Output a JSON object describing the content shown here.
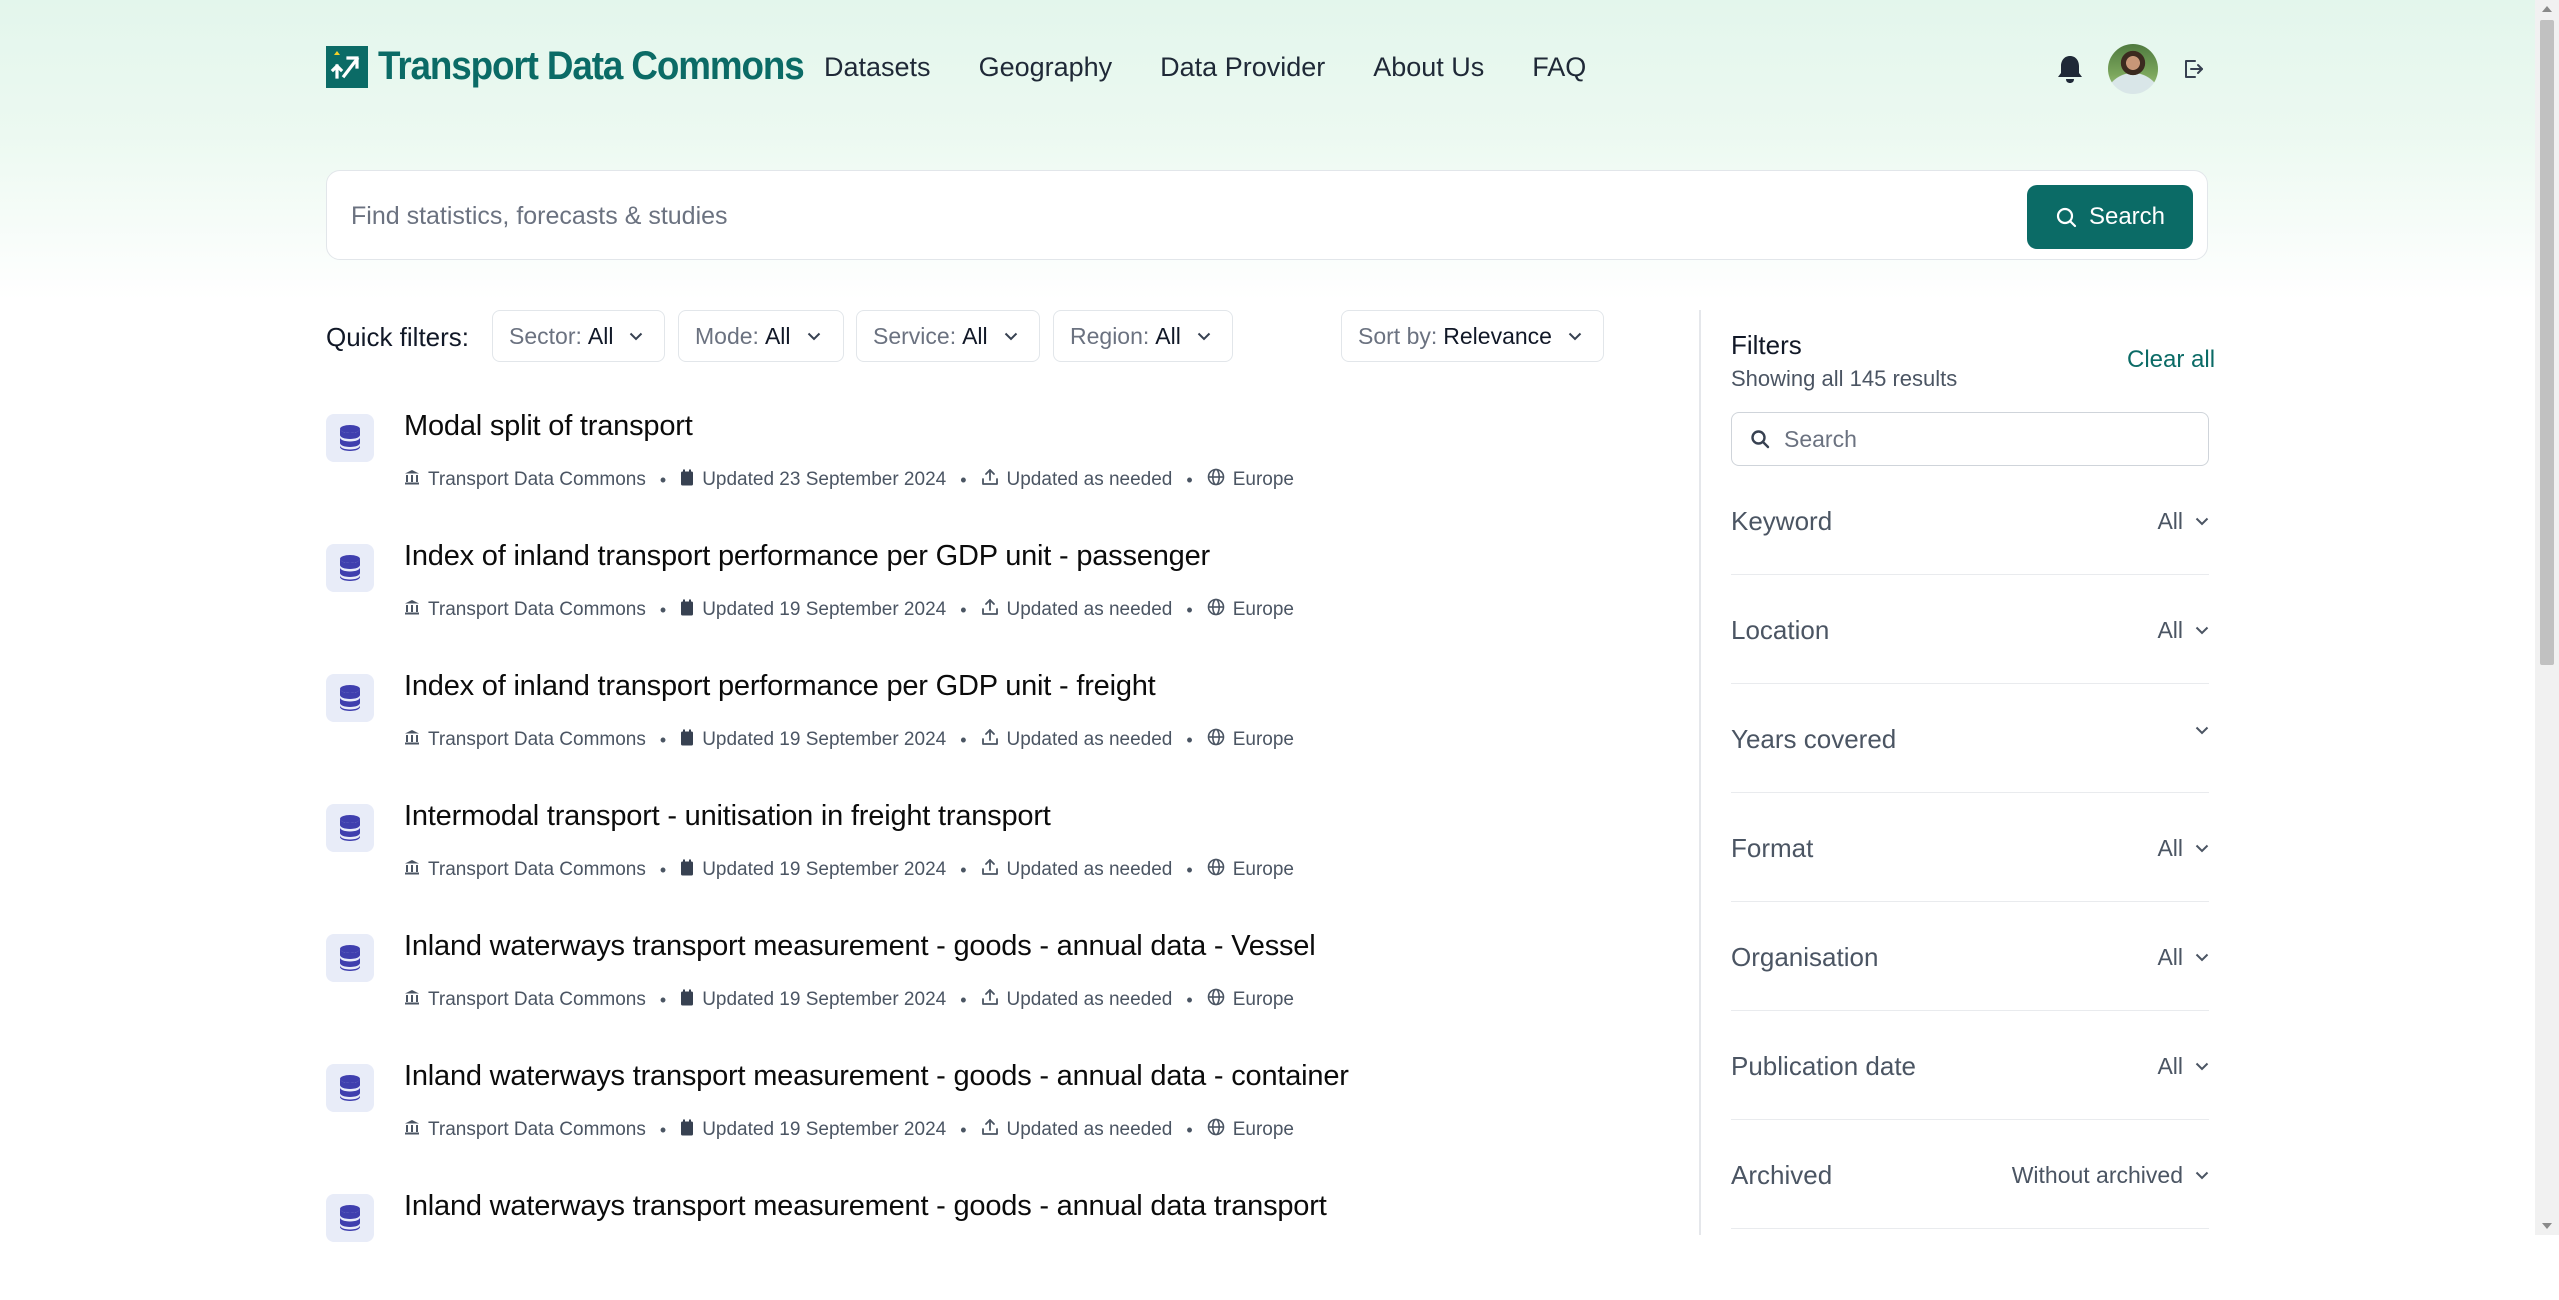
{
  "brand": {
    "name": "Transport Data Commons",
    "color": "#0b6b66"
  },
  "nav": [
    "Datasets",
    "Geography",
    "Data Provider",
    "About Us",
    "FAQ"
  ],
  "header_icons": [
    "bell-icon",
    "avatar",
    "logout-icon"
  ],
  "search": {
    "placeholder": "Find statistics, forecasts & studies",
    "button_label": "Search"
  },
  "quick_filters": {
    "label": "Quick filters:",
    "chips": [
      {
        "name": "Sector:",
        "value": "All"
      },
      {
        "name": "Mode:",
        "value": "All"
      },
      {
        "name": "Service:",
        "value": "All"
      },
      {
        "name": "Region:",
        "value": "All"
      }
    ],
    "sort": {
      "name": "Sort by:",
      "value": "Relevance"
    }
  },
  "results": [
    {
      "title": "Modal split of transport",
      "provider": "Transport Data Commons",
      "updated": "Updated 23 September 2024",
      "frequency": "Updated as needed",
      "region": "Europe"
    },
    {
      "title": "Index of inland transport performance per GDP unit - passenger",
      "provider": "Transport Data Commons",
      "updated": "Updated 19 September 2024",
      "frequency": "Updated as needed",
      "region": "Europe"
    },
    {
      "title": "Index of inland transport performance per GDP unit - freight",
      "provider": "Transport Data Commons",
      "updated": "Updated 19 September 2024",
      "frequency": "Updated as needed",
      "region": "Europe"
    },
    {
      "title": "Intermodal transport - unitisation in freight transport",
      "provider": "Transport Data Commons",
      "updated": "Updated 19 September 2024",
      "frequency": "Updated as needed",
      "region": "Europe"
    },
    {
      "title": "Inland waterways transport measurement - goods - annual data - Vessel",
      "provider": "Transport Data Commons",
      "updated": "Updated 19 September 2024",
      "frequency": "Updated as needed",
      "region": "Europe"
    },
    {
      "title": "Inland waterways transport measurement - goods - annual data - container",
      "provider": "Transport Data Commons",
      "updated": "Updated 19 September 2024",
      "frequency": "Updated as needed",
      "region": "Europe"
    },
    {
      "title": "Inland waterways transport measurement - goods - annual data transport",
      "provider": "",
      "updated": "",
      "frequency": "",
      "region": ""
    }
  ],
  "filters": {
    "title": "Filters",
    "showing": "Showing all 145 results",
    "clear_all": "Clear all",
    "search_placeholder": "Search",
    "rows": [
      {
        "label": "Keyword",
        "value": "All"
      },
      {
        "label": "Location",
        "value": "All"
      },
      {
        "label": "Years covered",
        "value": ""
      },
      {
        "label": "Format",
        "value": "All"
      },
      {
        "label": "Organisation",
        "value": "All"
      },
      {
        "label": "Publication date",
        "value": "All"
      },
      {
        "label": "Archived",
        "value": "Without archived"
      }
    ]
  },
  "colors": {
    "accent": "#0b6b66",
    "dataset_icon": "#3f3fae",
    "dataset_icon_bg": "#e8ecf8"
  }
}
